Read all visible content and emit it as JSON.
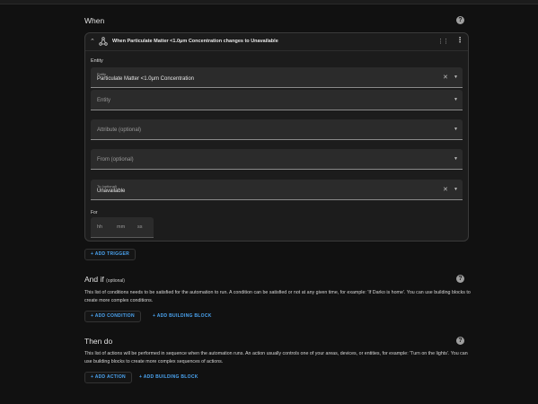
{
  "when": {
    "title": "When",
    "trigger": {
      "title": "When Particulate Matter <1.0μm Concentration changes to Unavailable",
      "entity_section_label": "Entity",
      "fields": [
        {
          "label": "Entity",
          "value": "Particulate Matter <1.0μm Concentration",
          "placeholder": ""
        },
        {
          "label": "",
          "value": "",
          "placeholder": "Entity"
        },
        {
          "label": "",
          "value": "",
          "placeholder": "Attribute (optional)"
        },
        {
          "label": "",
          "value": "",
          "placeholder": "From (optional)"
        },
        {
          "label": "To (optional)",
          "value": "Unavailable",
          "placeholder": ""
        }
      ],
      "for_label": "For",
      "duration": {
        "hh": "hh",
        "mm": "mm",
        "ss": "ss"
      }
    },
    "add_trigger": "+ ADD TRIGGER"
  },
  "and_if": {
    "title": "And if",
    "subtitle": "(optional)",
    "description": "This list of conditions needs to be satisfied for the automation to run. A condition can be satisfied or not at any given time, for example: 'If Darko is home'. You can use building blocks to create more complex conditions.",
    "add_condition": "+ ADD CONDITION",
    "add_building_block": "+ ADD BUILDING BLOCK"
  },
  "then_do": {
    "title": "Then do",
    "description": "This list of actions will be performed in sequence when the automation runs. An action usually controls one of your areas, devices, or entities, for example: 'Turn on the lights'. You can use building blocks to create more complex sequences of actions.",
    "add_action": "+ ADD ACTION",
    "add_building_block": "+ ADD BUILDING BLOCK"
  },
  "icons": {
    "help": "help-circle-icon",
    "collapse": "chevron-up-icon",
    "trigger": "state-node-icon",
    "drag": "drag-handle-icon",
    "more": "dots-vertical-icon",
    "clear": "close-icon",
    "dropdown": "menu-down-icon"
  },
  "colors": {
    "accent": "#4aa3f0",
    "background": "#111111",
    "card": "#1c1c1c",
    "field": "#2b2b2b"
  }
}
